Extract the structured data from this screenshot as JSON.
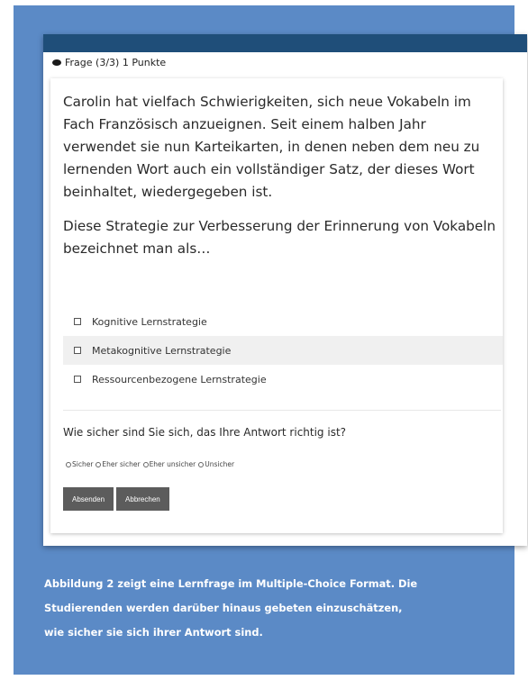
{
  "header": {
    "title": "Frage (3/3) 1 Punkte"
  },
  "question": {
    "paragraph1": "Carolin hat vielfach Schwierigkeiten, sich neue Vokabeln im Fach Französisch anzueignen. Seit einem halben Jahr verwendet sie nun Karteikarten, in denen neben dem neu zu lernenden Wort auch ein vollständiger Satz, der dieses Wort beinhaltet, wiedergegeben ist.",
    "paragraph2": "Diese Strategie zur Verbesserung der Erinnerung von Vokabeln bezeichnet man als…"
  },
  "options": [
    "Kognitive Lernstrategie",
    "Metakognitive Lernstrategie",
    "Ressourcenbezogene Lernstrategie"
  ],
  "confidence": {
    "question": "Wie sicher sind Sie sich, das Ihre Antwort richtig ist?",
    "choices": [
      "Sicher",
      "Eher sicher",
      "Eher unsicher",
      "Unsicher"
    ]
  },
  "buttons": {
    "submit": "Absenden",
    "cancel": "Abbrechen"
  },
  "caption": {
    "line1": "Abbildung 2 zeigt eine Lernfrage im Multiple-Choice Format. Die",
    "line2": "Studierenden werden darüber hinaus gebeten einzuschätzen,",
    "line3": "wie sicher sie sich ihrer Antwort sind."
  },
  "colors": {
    "panel": "#5b8ac6",
    "topbar": "#1f4e79",
    "button": "#5c5c5c"
  }
}
